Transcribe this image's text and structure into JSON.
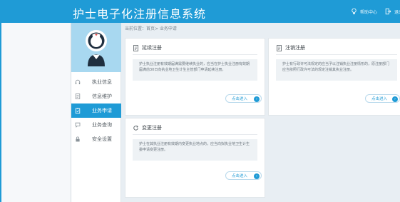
{
  "header": {
    "title": "护士电子化注册信息系统",
    "help_label": "帮助中心",
    "logout_label": "退出"
  },
  "sidebar": {
    "items": [
      {
        "label": "执业信息",
        "icon": "headset-icon",
        "active": false
      },
      {
        "label": "信息维护",
        "icon": "document-icon",
        "active": false
      },
      {
        "label": "业务申请",
        "icon": "clipboard-icon",
        "active": true
      },
      {
        "label": "业务查询",
        "icon": "chat-icon",
        "active": false
      },
      {
        "label": "安全设置",
        "icon": "lock-icon",
        "active": false
      }
    ]
  },
  "breadcrumb": "当前位置：首页> 业务申请",
  "cards": {
    "extend": {
      "title": "延续注册",
      "description": "护士执业注册有效期届满需要继续执业的，应当在护士执业注册有效期届满前30日向执业地卫生计生主管部门申请延续注册。",
      "button": "点击进入"
    },
    "cancel": {
      "title": "注销注册",
      "description": "护士有行政许可法规定的应当予以注销执业注册情形的，原注册部门应当依照行政许可法的规定注销其执业注册。",
      "button": "点击进入"
    },
    "change": {
      "title": "变更注册",
      "description": "护士在其执业注册有效期内变更执业地点的，应当向拟执业地卫生计生委申请变更注册。",
      "button": "点击进入"
    }
  },
  "colors": {
    "brand": "#1f9bd6",
    "profile_bg": "#a8d8f0",
    "page_bg": "#e8eef3"
  }
}
